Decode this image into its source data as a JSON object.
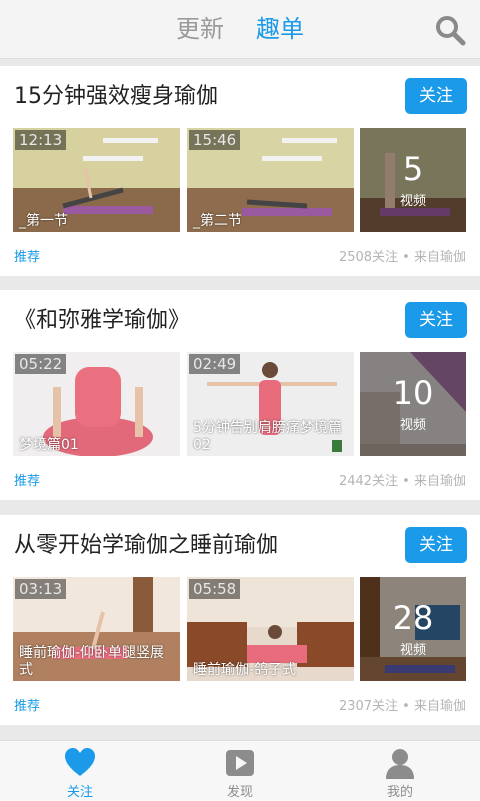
{
  "header": {
    "tabs": [
      {
        "label": "更新",
        "active": false
      },
      {
        "label": "趣单",
        "active": true
      }
    ],
    "search_icon": "search-icon"
  },
  "colors": {
    "accent": "#1a9ae8",
    "muted": "#9a9a9a",
    "meta": "#b5b5b5"
  },
  "playlists": [
    {
      "title": "15分钟强效瘦身瑜伽",
      "follow_label": "关注",
      "videos": [
        {
          "duration": "12:13",
          "caption": "_第一节"
        },
        {
          "duration": "15:46",
          "caption": "_第二节"
        }
      ],
      "video_count": "5",
      "video_count_label": "视频",
      "tag": "推荐",
      "meta": "2508关注 • 来自瑜伽"
    },
    {
      "title": "《和弥雅学瑜伽》",
      "follow_label": "关注",
      "videos": [
        {
          "duration": "05:22",
          "caption": "梦境篇01"
        },
        {
          "duration": "02:49",
          "caption": "5分钟告别肩膀痛梦境篇02"
        }
      ],
      "video_count": "10",
      "video_count_label": "视频",
      "tag": "推荐",
      "meta": "2442关注 • 来自瑜伽"
    },
    {
      "title": "从零开始学瑜伽之睡前瑜伽",
      "follow_label": "关注",
      "videos": [
        {
          "duration": "03:13",
          "caption": "睡前瑜伽-仰卧单腿竖展式"
        },
        {
          "duration": "05:58",
          "caption": "睡前瑜伽-鸽子式"
        }
      ],
      "video_count": "28",
      "video_count_label": "视频",
      "tag": "推荐",
      "meta": "2307关注 • 来自瑜伽"
    }
  ],
  "bottom_nav": [
    {
      "label": "关注",
      "icon": "heart-icon",
      "active": true
    },
    {
      "label": "发现",
      "icon": "play-icon",
      "active": false
    },
    {
      "label": "我的",
      "icon": "user-icon",
      "active": false
    }
  ]
}
